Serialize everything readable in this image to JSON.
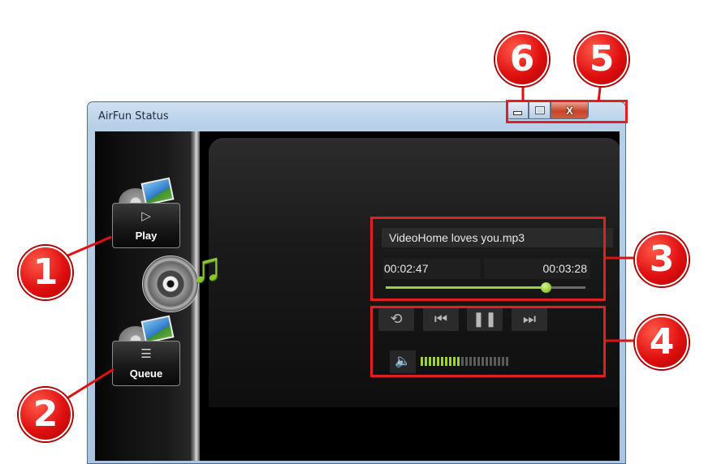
{
  "window": {
    "title": "AirFun Status"
  },
  "caption_buttons": {
    "minimize_glyph": "",
    "maximize_glyph": "",
    "close_glyph": "X"
  },
  "sidebar": {
    "items": [
      {
        "label": "Play",
        "glyph": "▷",
        "icon": "play-icon"
      },
      {
        "label": "Queue",
        "glyph": "☰",
        "icon": "queue-list-icon"
      }
    ]
  },
  "player": {
    "track_name": "VideoHome loves you.mp3",
    "elapsed": "00:02:47",
    "duration": "00:03:28",
    "progress_fraction": 0.8,
    "controls": {
      "repeat": "⟲",
      "previous": "⏮",
      "pause": "❚❚",
      "next": "⏭"
    },
    "volume": {
      "icon": "speaker-icon",
      "glyph": "🔈",
      "level_bars": 10,
      "total_bars": 22
    }
  },
  "callouts": [
    "1",
    "2",
    "3",
    "4",
    "5",
    "6"
  ],
  "colors": {
    "accent_green": "#9fd233",
    "callout_red": "#e01010"
  }
}
